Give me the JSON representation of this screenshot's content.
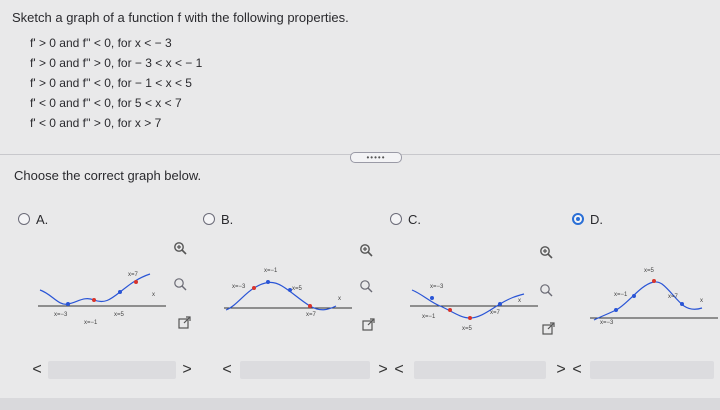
{
  "question": {
    "prompt": "Sketch a graph of a function f with the following properties.",
    "properties": [
      "f' > 0 and f'' < 0, for x < − 3",
      "f' > 0 and f'' > 0, for − 3 < x < − 1",
      "f' > 0 and f'' < 0, for − 1 < x < 5",
      "f' < 0 and f'' < 0, for 5 < x < 7",
      "f' < 0 and f'' > 0, for x > 7"
    ],
    "more_label": "•••••",
    "instruction": "Choose the correct graph below."
  },
  "options": [
    {
      "letter": "A.",
      "selected": false,
      "labels": {
        "a": "x=7",
        "b": "x=−3",
        "c": "x=5",
        "d": "x=−1",
        "axis": "x"
      }
    },
    {
      "letter": "B.",
      "selected": false,
      "labels": {
        "a": "x=−1",
        "b": "x=−3",
        "c": "x=5",
        "d": "x=7",
        "axis": "x"
      }
    },
    {
      "letter": "C.",
      "selected": false,
      "labels": {
        "a": "x=−3",
        "b": "x=−1",
        "c": "x=7",
        "d": "x=5",
        "axis": "x"
      }
    },
    {
      "letter": "D.",
      "selected": true,
      "labels": {
        "a": "x=5",
        "b": "x=−1",
        "c": "x=7",
        "d": "x=−3",
        "axis": "x"
      }
    }
  ],
  "nav": {
    "prev": "<",
    "next": ">"
  },
  "colors": {
    "accent": "#2a6fd6",
    "red_point": "#d9342b",
    "blue_point": "#2a55d6"
  }
}
